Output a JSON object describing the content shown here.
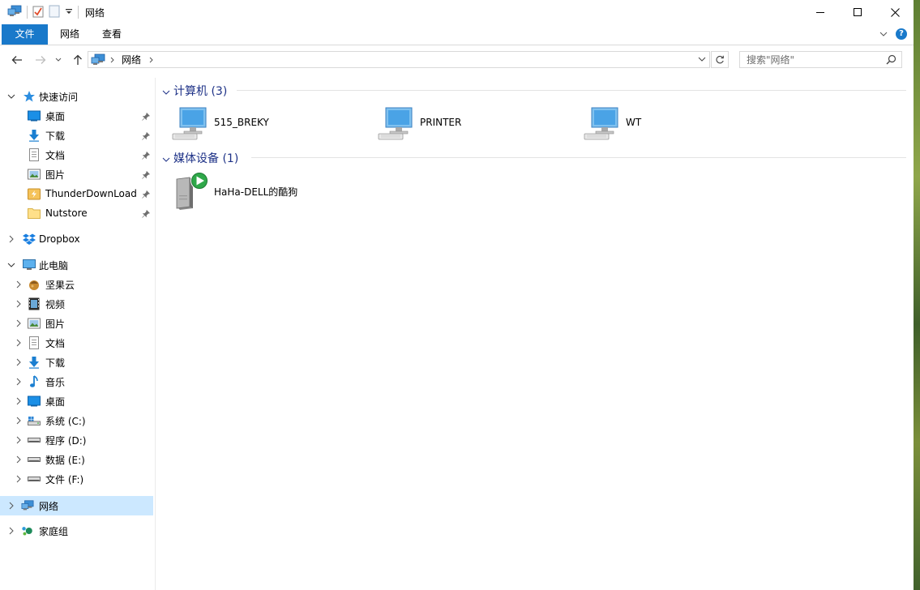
{
  "window": {
    "title": "网络"
  },
  "ribbon": {
    "tabs": [
      "文件",
      "网络",
      "查看"
    ]
  },
  "address": {
    "crumbs": [
      "网络"
    ]
  },
  "search": {
    "placeholder": "搜索\"网络\""
  },
  "sidebar": {
    "quick_access": "快速访问",
    "quick_items": [
      "桌面",
      "下载",
      "文档",
      "图片",
      "ThunderDownLoad",
      "Nutstore"
    ],
    "dropbox": "Dropbox",
    "this_pc": "此电脑",
    "pc_items": [
      "坚果云",
      "视频",
      "图片",
      "文档",
      "下载",
      "音乐",
      "桌面",
      "系统 (C:)",
      "程序 (D:)",
      "数据 (E:)",
      "文件 (F:)"
    ],
    "network": "网络",
    "homegroup": "家庭组"
  },
  "content": {
    "groups": [
      {
        "label": "计算机 (3)",
        "items": [
          "515_BREKY",
          "PRINTER",
          "WT"
        ]
      },
      {
        "label": "媒体设备 (1)",
        "items": [
          "HaHa-DELL的酷狗"
        ]
      }
    ]
  },
  "colors": {
    "accent": "#1979ca",
    "selection": "#cce8ff",
    "group_header": "#1e3287"
  }
}
